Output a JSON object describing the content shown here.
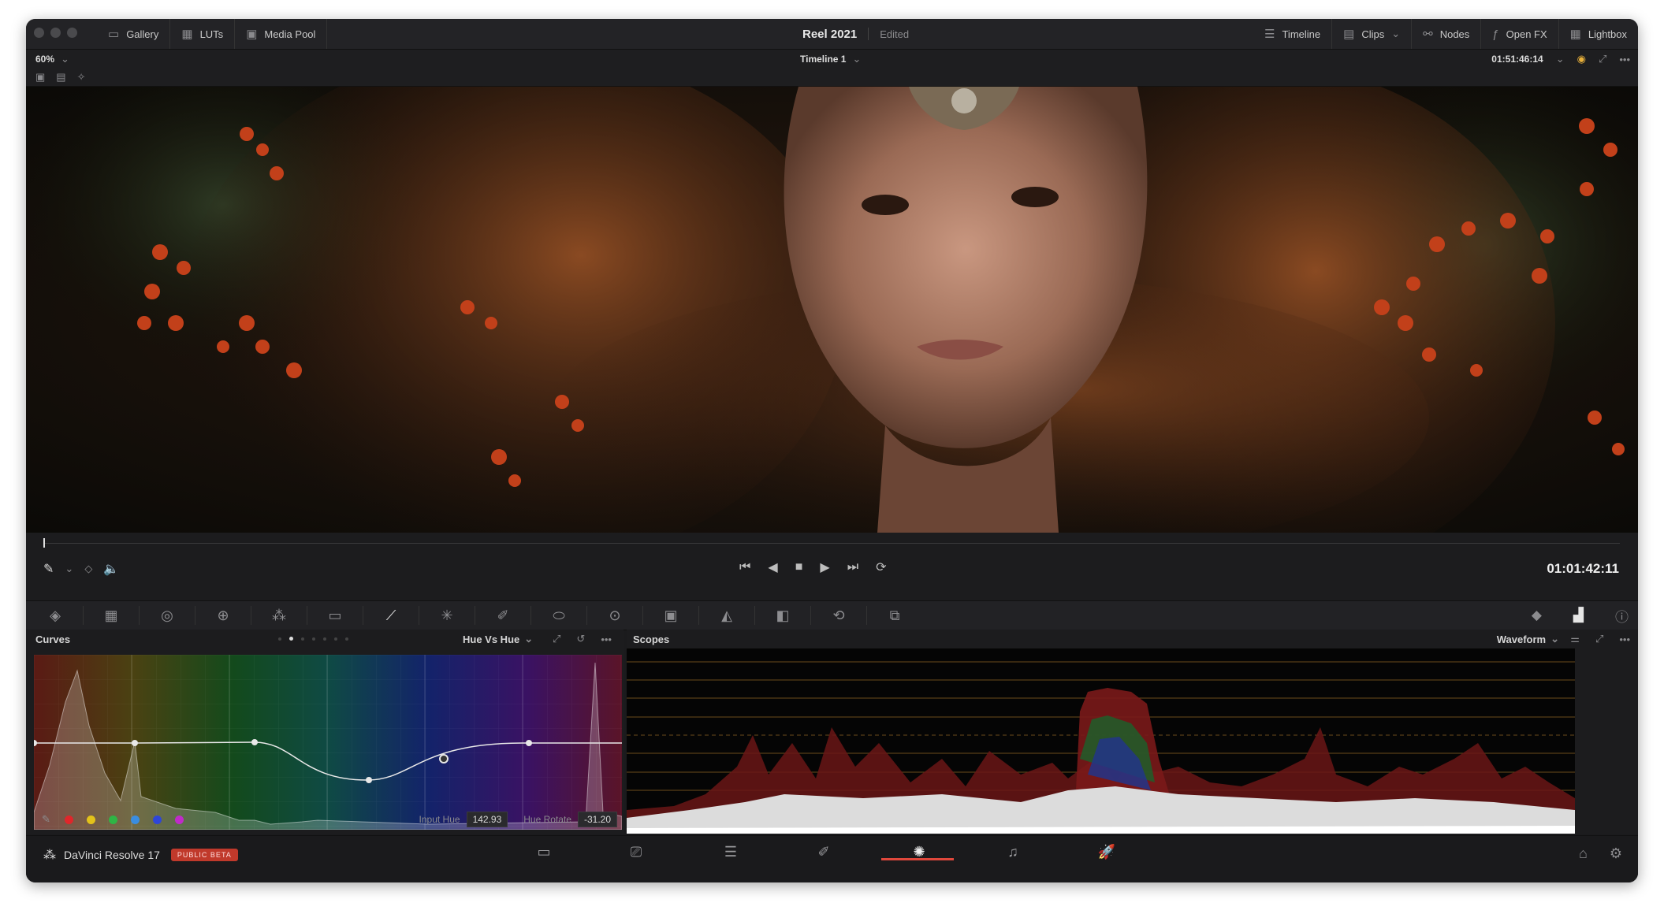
{
  "titlebar": {
    "left_buttons": [
      {
        "label": "Gallery",
        "icon": "gallery-icon",
        "glyph": "▭"
      },
      {
        "label": "LUTs",
        "icon": "luts-icon",
        "glyph": "▦"
      },
      {
        "label": "Media Pool",
        "icon": "media-pool-icon",
        "glyph": "▣"
      }
    ],
    "project_title": "Reel 2021",
    "project_status": "Edited",
    "right_buttons": [
      {
        "label": "Timeline",
        "icon": "timeline-icon",
        "glyph": "☰"
      },
      {
        "label": "Clips",
        "icon": "clips-icon",
        "glyph": "▤"
      },
      {
        "label": "Nodes",
        "icon": "nodes-icon",
        "glyph": "⚯"
      },
      {
        "label": "Open FX",
        "icon": "open-fx-icon",
        "glyph": "ƒ"
      },
      {
        "label": "Lightbox",
        "icon": "lightbox-icon",
        "glyph": "▦"
      }
    ]
  },
  "viewer_bar": {
    "zoom": "60%",
    "timeline_name": "Timeline 1",
    "source_timecode": "01:51:46:14"
  },
  "transport": {
    "timecode": "01:01:42:11"
  },
  "curves": {
    "title": "Curves",
    "mode": "Hue Vs Hue",
    "input_hue_label": "Input Hue",
    "input_hue_value": "142.93",
    "hue_rotate_label": "Hue Rotate",
    "hue_rotate_value": "-31.20",
    "swatch_colors": [
      "#e0262b",
      "#e3c21a",
      "#2fb545",
      "#3a8de0",
      "#2e46d8",
      "#c02bc9"
    ]
  },
  "scopes": {
    "title": "Scopes",
    "mode": "Waveform"
  },
  "app": {
    "name": "DaVinci Resolve 17",
    "badge": "PUBLIC BETA",
    "badge_color": "#c0392b",
    "accent_color": "#e0483c"
  }
}
